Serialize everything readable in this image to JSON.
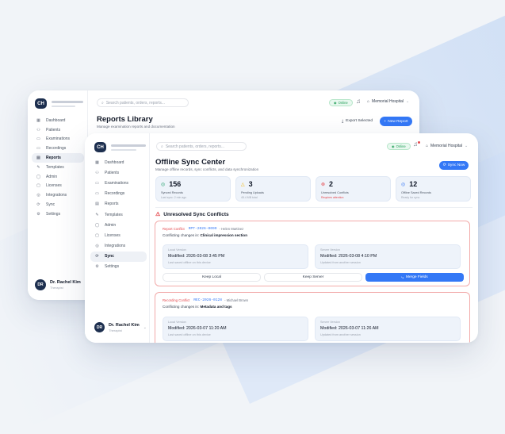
{
  "back": {
    "search_placeholder": "Search patients, orders, reports...",
    "status": "Online",
    "hospital": "Memorial Hospital",
    "page_title": "Reports Library",
    "page_subtitle": "Manage examination reports and documentation",
    "export_label": "Export Selected",
    "new_label": "New Report",
    "nav": [
      {
        "label": "Dashboard",
        "icon": "dashboard-icon"
      },
      {
        "label": "Patients",
        "icon": "patients-icon"
      },
      {
        "label": "Examinations",
        "icon": "examinations-icon"
      },
      {
        "label": "Recordings",
        "icon": "recordings-icon"
      },
      {
        "label": "Reports",
        "icon": "reports-icon"
      },
      {
        "label": "Templates",
        "icon": "templates-icon"
      },
      {
        "label": "Admin",
        "icon": "admin-icon"
      },
      {
        "label": "Licenses",
        "icon": "licenses-icon"
      },
      {
        "label": "Integrations",
        "icon": "integrations-icon"
      },
      {
        "label": "Sync",
        "icon": "sync-icon"
      },
      {
        "label": "Settings",
        "icon": "settings-icon"
      }
    ],
    "user_name": "Dr. Rachel Kim",
    "user_role": "Therapist",
    "user_initials": "DR"
  },
  "front": {
    "search_placeholder": "Search patients, orders, reports...",
    "status": "Online",
    "hospital": "Memorial Hospital",
    "page_title": "Offline Sync Center",
    "page_subtitle": "Manage offline records, sync conflicts, and data synchronization",
    "sync_now_label": "Sync Now",
    "nav": [
      {
        "label": "Dashboard",
        "icon": "dashboard-icon"
      },
      {
        "label": "Patients",
        "icon": "patients-icon"
      },
      {
        "label": "Examinations",
        "icon": "examinations-icon"
      },
      {
        "label": "Recordings",
        "icon": "recordings-icon"
      },
      {
        "label": "Reports",
        "icon": "reports-icon"
      },
      {
        "label": "Templates",
        "icon": "templates-icon"
      },
      {
        "label": "Admin",
        "icon": "admin-icon"
      },
      {
        "label": "Licenses",
        "icon": "licenses-icon"
      },
      {
        "label": "Integrations",
        "icon": "integrations-icon"
      },
      {
        "label": "Sync",
        "icon": "sync-icon"
      },
      {
        "label": "Settings",
        "icon": "settings-icon"
      }
    ],
    "stats": [
      {
        "value": "156",
        "label": "Synced Records",
        "sub": "Last sync: 2 min ago",
        "icon": "check-circle-icon",
        "color": "#22a06b"
      },
      {
        "value": "3",
        "label": "Pending Uploads",
        "sub": "45.4 MB total",
        "icon": "warning-icon",
        "color": "#f4b400"
      },
      {
        "value": "2",
        "label": "Unresolved Conflicts",
        "sub": "Requires attention",
        "icon": "error-icon",
        "color": "#e5484d"
      },
      {
        "value": "12",
        "label": "Offline Saved Records",
        "sub": "Ready for sync",
        "icon": "info-icon",
        "color": "#3478f6"
      }
    ],
    "conflicts_title": "Unresolved Sync Conflicts",
    "conflicts": [
      {
        "type": "Report Conflict",
        "id": "RPT-2026-0099",
        "patient": "- Helen Martinez",
        "desc_prefix": "Conflicting changes in:",
        "desc_field": "Clinical impression section",
        "local_label": "Local Version",
        "local_modified": "Modified: 2026-03-08 3:45 PM",
        "local_note": "Last saved offline on this device",
        "server_label": "Server Version",
        "server_modified": "Modified: 2026-03-08 4:10 PM",
        "server_note": "Updated from another session",
        "keep_local": "Keep Local",
        "keep_server": "Keep Server",
        "merge": "Merge Fields"
      },
      {
        "type": "Recording Conflict",
        "id": "REC-2026-0128",
        "patient": "- Michael Brown",
        "desc_prefix": "Conflicting changes in:",
        "desc_field": "Metadata and tags",
        "local_label": "Local Version",
        "local_modified": "Modified: 2026-03-07 11:20 AM",
        "local_note": "Last saved offline on this device",
        "server_label": "Server Version",
        "server_modified": "Modified: 2026-03-07 11:26 AM",
        "server_note": "Updated from another session"
      }
    ],
    "user_name": "Dr. Rachel Kim",
    "user_role": "Therapist",
    "user_initials": "DR"
  }
}
